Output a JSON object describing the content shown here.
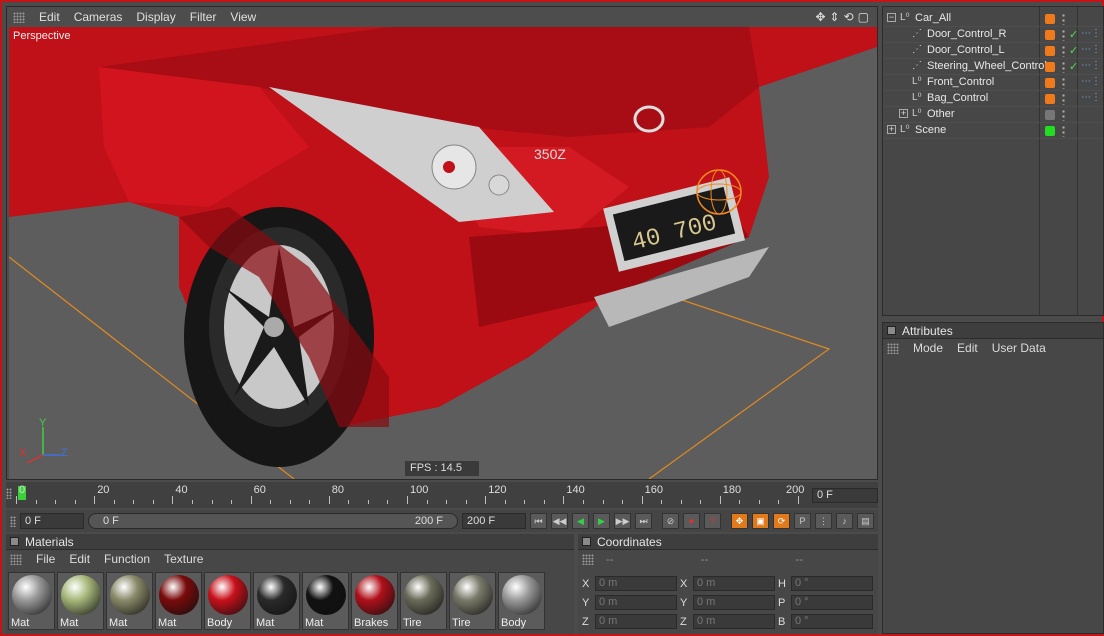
{
  "viewport": {
    "menu": [
      "Edit",
      "Cameras",
      "Display",
      "Filter",
      "View"
    ],
    "camera_label": "Perspective",
    "fps": "FPS : 14.5",
    "axes": {
      "x": "X",
      "y": "Y",
      "z": "Z"
    },
    "nav_icons": [
      "move-icon",
      "zoom-icon",
      "rotate-icon",
      "maximize-icon"
    ]
  },
  "timeline": {
    "tick_labels": [
      "0",
      "20",
      "40",
      "60",
      "80",
      "100",
      "120",
      "140",
      "160",
      "180",
      "200"
    ],
    "current_frame": "0 F",
    "start_field": "0 F",
    "range_start": "0 F",
    "range_end": "200 F",
    "end_field": "200 F"
  },
  "materials": {
    "title": "Materials",
    "menu": [
      "File",
      "Edit",
      "Function",
      "Texture"
    ],
    "items": [
      {
        "label": "Mat",
        "color": "#9a9a9a"
      },
      {
        "label": "Mat",
        "color": "#a7b87a"
      },
      {
        "label": "Mat",
        "color": "#8a8a6a"
      },
      {
        "label": "Mat",
        "color": "#7a0a0a"
      },
      {
        "label": "Body",
        "color": "#c8101a"
      },
      {
        "label": "Mat",
        "color": "#2a2a2a"
      },
      {
        "label": "Mat",
        "color": "#111111"
      },
      {
        "label": "Brakes",
        "color": "#b0101a"
      },
      {
        "label": "Tire",
        "color": "#6b6b5a"
      },
      {
        "label": "Tire",
        "color": "#7a7a6a"
      },
      {
        "label": "Body",
        "color": "#9a9a9a"
      }
    ]
  },
  "coordinates": {
    "title": "Coordinates",
    "headers": [
      "--",
      "--",
      "--"
    ],
    "rows": [
      {
        "a": "X",
        "av": "0 m",
        "b": "X",
        "bv": "0 m",
        "c": "H",
        "cv": "0 °"
      },
      {
        "a": "Y",
        "av": "0 m",
        "b": "Y",
        "bv": "0 m",
        "c": "P",
        "cv": "0 °"
      },
      {
        "a": "Z",
        "av": "0 m",
        "b": "Z",
        "bv": "0 m",
        "c": "B",
        "cv": "0 °"
      }
    ]
  },
  "objects": {
    "items": [
      {
        "name": "Car_All",
        "level": 0,
        "expand": "−",
        "tag_color": "#f07a1a",
        "check": false
      },
      {
        "name": "Door_Control_R",
        "level": 1,
        "expand": "",
        "tag_color": "#f07a1a",
        "check": true
      },
      {
        "name": "Door_Control_L",
        "level": 1,
        "expand": "",
        "tag_color": "#f07a1a",
        "check": true
      },
      {
        "name": "Steering_Wheel_Control",
        "level": 1,
        "expand": "",
        "tag_color": "#f07a1a",
        "check": true
      },
      {
        "name": "Front_Control",
        "level": 1,
        "expand": "",
        "tag_color": "#f07a1a",
        "check": false
      },
      {
        "name": "Bag_Control",
        "level": 1,
        "expand": "",
        "tag_color": "#f07a1a",
        "check": false
      },
      {
        "name": "Other",
        "level": 1,
        "expand": "+",
        "tag_color": "#777777",
        "check": false
      },
      {
        "name": "Scene",
        "level": 0,
        "expand": "+",
        "tag_color": "#22dd22",
        "check": false
      }
    ]
  },
  "attributes": {
    "title": "Attributes",
    "menu": [
      "Mode",
      "Edit",
      "User Data"
    ]
  }
}
